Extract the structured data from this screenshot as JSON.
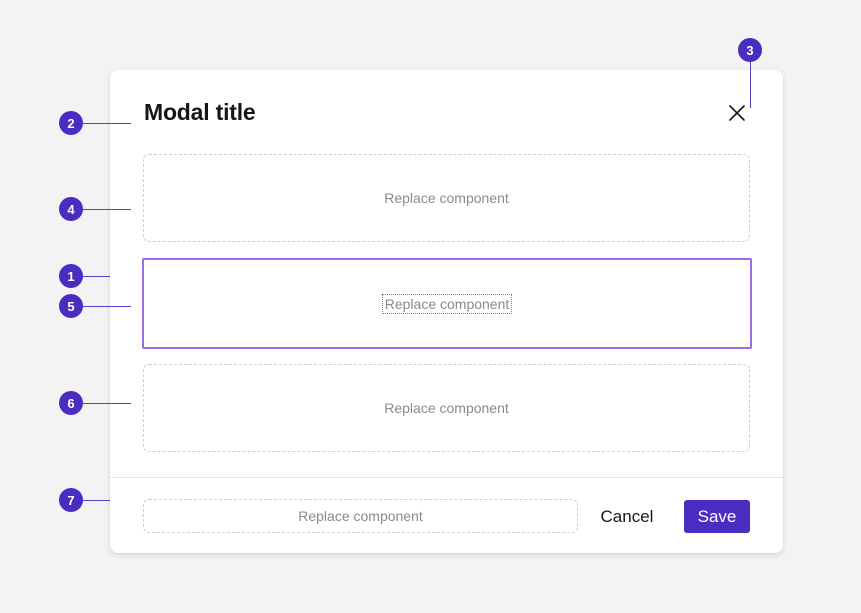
{
  "modal": {
    "title": "Modal title",
    "close_icon": "close-icon",
    "slots": [
      {
        "label": "Replace component",
        "state": "default"
      },
      {
        "label": "Replace component",
        "state": "selected"
      },
      {
        "label": "Replace component",
        "state": "default"
      }
    ],
    "footer": {
      "slot_label": "Replace component",
      "cancel_label": "Cancel",
      "save_label": "Save"
    }
  },
  "markers": [
    "1",
    "2",
    "3",
    "4",
    "5",
    "6",
    "7"
  ],
  "colors": {
    "accent": "#4a2dc0",
    "selection": "#9b6ce8",
    "placeholder_border": "#cfcfd3",
    "background": "#f3f3f3"
  }
}
